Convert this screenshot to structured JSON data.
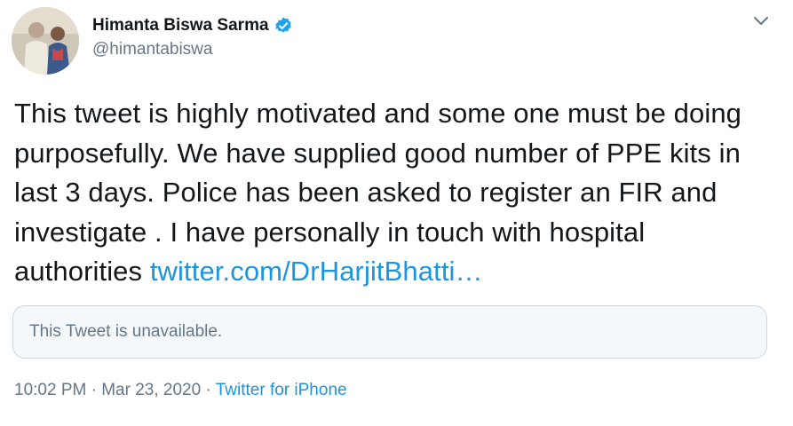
{
  "author": {
    "name": "Himanta Biswa Sarma",
    "handle": "@himantabiswa"
  },
  "tweet": {
    "text": "This tweet is highly motivated and some one must be doing purposefully. We have supplied good number of PPE kits in last 3 days. Police has been asked to register an FIR and investigate . I have personally in touch with hospital authorities ",
    "link": "twitter.com/DrHarjitBhatti…"
  },
  "quoted_tweet": {
    "text": "This Tweet is unavailable."
  },
  "meta": {
    "time": "10:02 PM",
    "separator": "·",
    "date": "Mar 23, 2020",
    "source": "Twitter for iPhone"
  },
  "colors": {
    "link": "#1b95e0",
    "secondary_text": "#657786",
    "verified_badge": "#1da1f2"
  },
  "icons": [
    "verified-badge-icon",
    "chevron-down-icon"
  ]
}
